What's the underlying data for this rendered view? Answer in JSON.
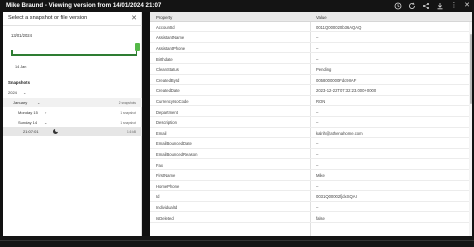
{
  "window": {
    "title": "Mike Braund - Viewing version from 14/01/2024 21:07",
    "icons": [
      "history-icon",
      "refresh-icon",
      "share-icon",
      "download-icon",
      "more-icon",
      "close-icon"
    ]
  },
  "snapshot_panel": {
    "title": "Select a snapshot or file version",
    "selected_date": "13/01/2024",
    "timeline_label": "14 Jan",
    "snapshots_header": "Snapshots",
    "year": "2024",
    "month": {
      "label": "January",
      "count": "2 snapshots"
    },
    "days": [
      {
        "label": "Monday 15",
        "count": "1 snapshot"
      },
      {
        "label": "Sunday 14",
        "count": "1 snapshot"
      }
    ],
    "time_entry": {
      "label": "21:07:01",
      "size": "1.6 kB"
    }
  },
  "properties_table": {
    "headers": {
      "property": "Property",
      "value": "Value"
    },
    "rows": [
      {
        "property": "AccountId",
        "value": "0011Q000020b36AQAQ"
      },
      {
        "property": "AssistantName",
        "value": "–"
      },
      {
        "property": "AssistantPhone",
        "value": "–"
      },
      {
        "property": "Birthdate",
        "value": "–"
      },
      {
        "property": "CleanStatus",
        "value": "Pending"
      },
      {
        "property": "CreatedById",
        "value": "0058000000Fdc9IIAF"
      },
      {
        "property": "CreatedDate",
        "value": "2023-12-22T07:32:23.000+0000"
      },
      {
        "property": "CurrencyIsoCode",
        "value": "RON"
      },
      {
        "property": "Department",
        "value": "–"
      },
      {
        "property": "Description",
        "value": "–"
      },
      {
        "property": "Email",
        "value": "kalrih@athenahome.com"
      },
      {
        "property": "EmailBouncedDate",
        "value": "–"
      },
      {
        "property": "EmailBouncedReason",
        "value": "–"
      },
      {
        "property": "Fax",
        "value": "–"
      },
      {
        "property": "FirstName",
        "value": "Mike"
      },
      {
        "property": "HomePhone",
        "value": "–"
      },
      {
        "property": "Id",
        "value": "0031Q00002fjdxSQAI"
      },
      {
        "property": "IndividualId",
        "value": "–"
      },
      {
        "property": "IsDeleted",
        "value": "false"
      }
    ]
  },
  "colors": {
    "accent": "#55b848",
    "timeline": "#2e7d32",
    "titlebar_bg": "#141414"
  }
}
